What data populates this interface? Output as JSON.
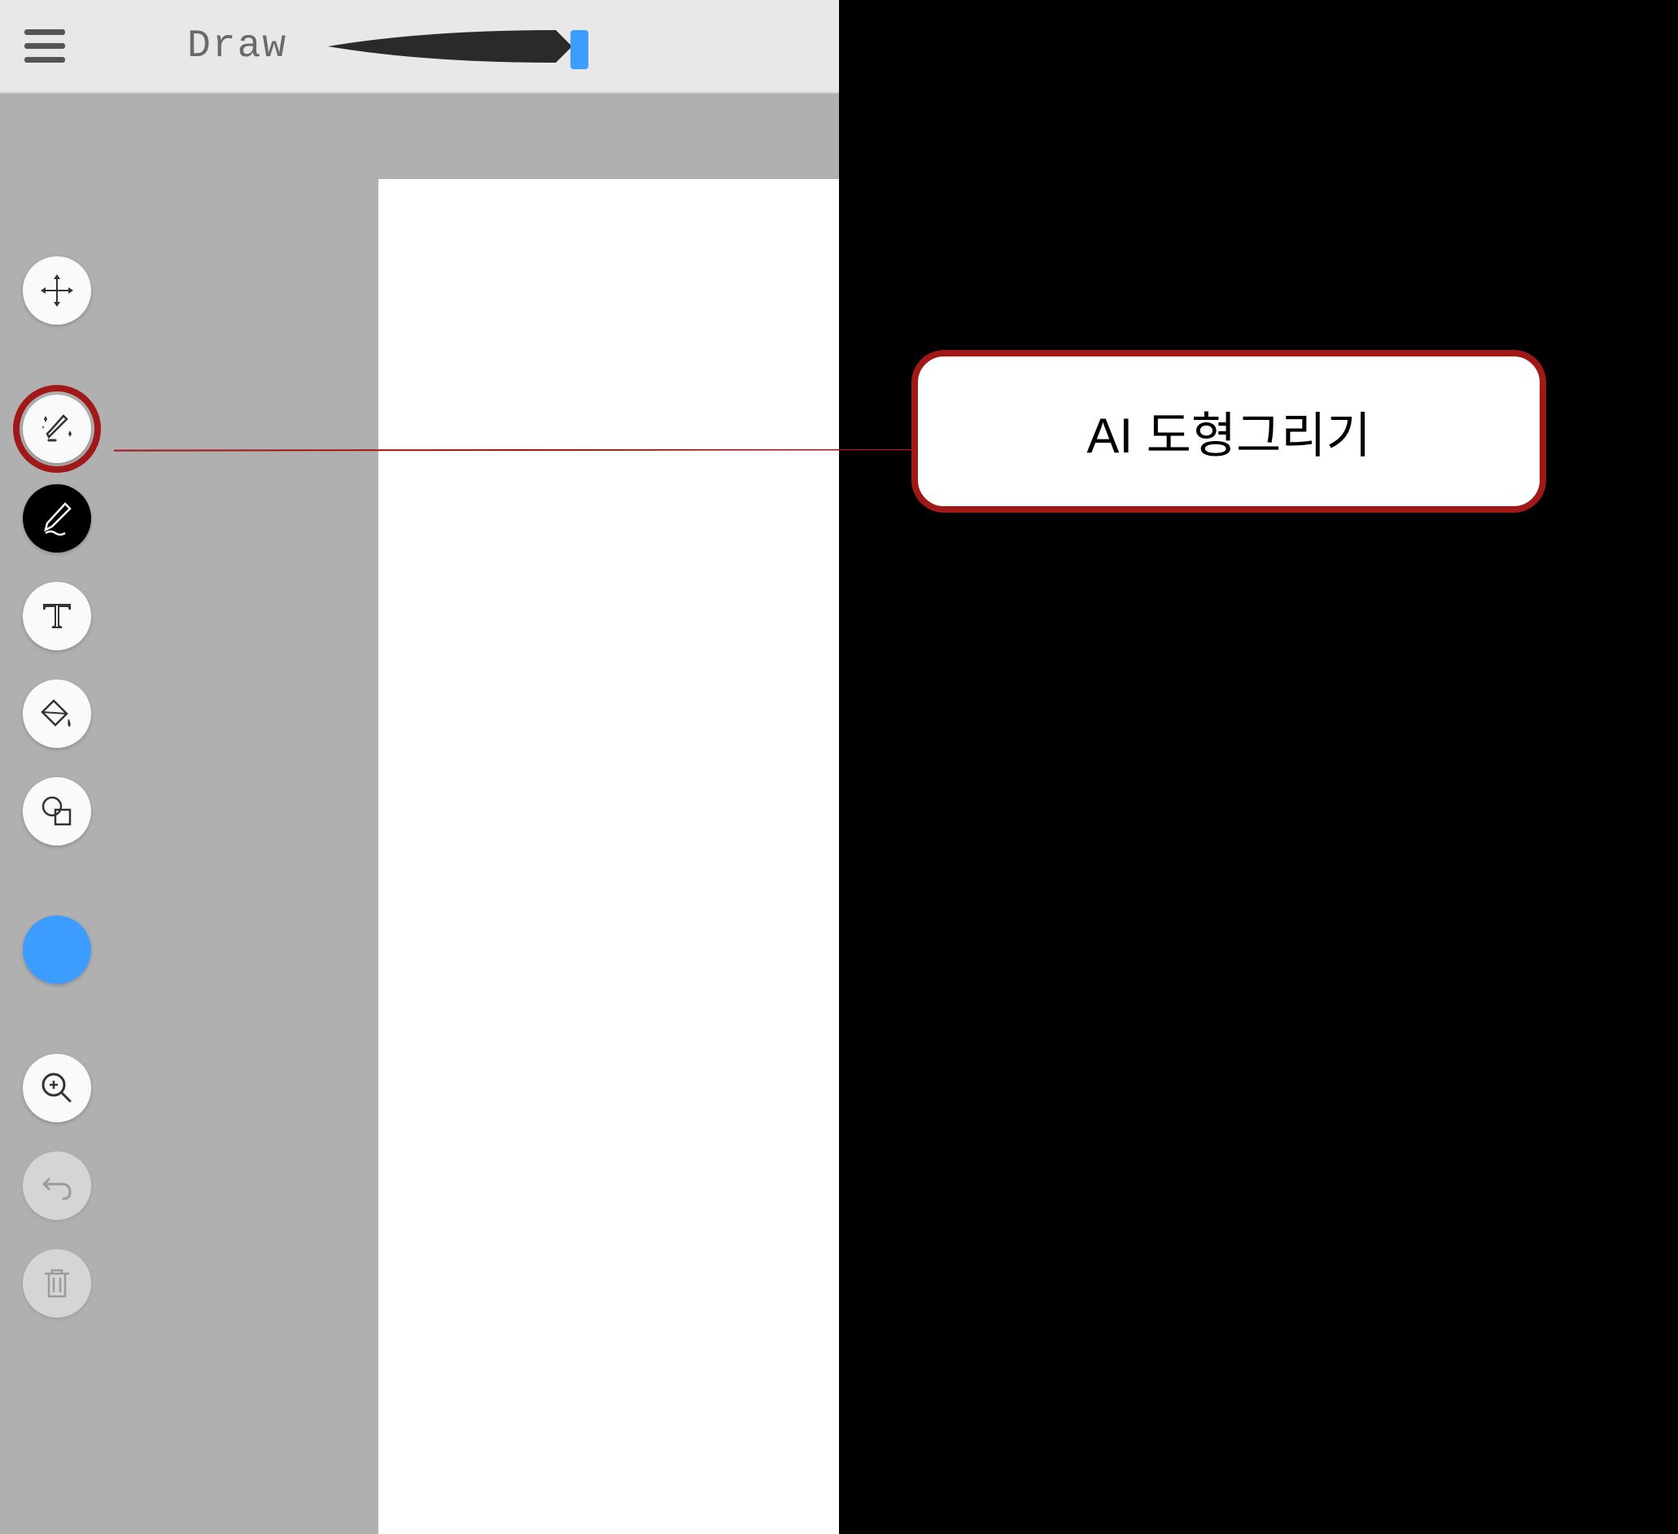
{
  "topbar": {
    "mode_label": "Draw"
  },
  "tools": {
    "move": "move-tool",
    "ai_shape": "ai-shape-drawing-tool",
    "pen": "pen-tool",
    "text": "text-tool",
    "fill": "fill-tool",
    "shapes": "shapes-tool",
    "zoom": "zoom-tool",
    "undo": "undo-tool",
    "delete": "delete-tool"
  },
  "colors": {
    "current": "#3d9cff"
  },
  "callout": {
    "label": "AI 도형그리기"
  }
}
